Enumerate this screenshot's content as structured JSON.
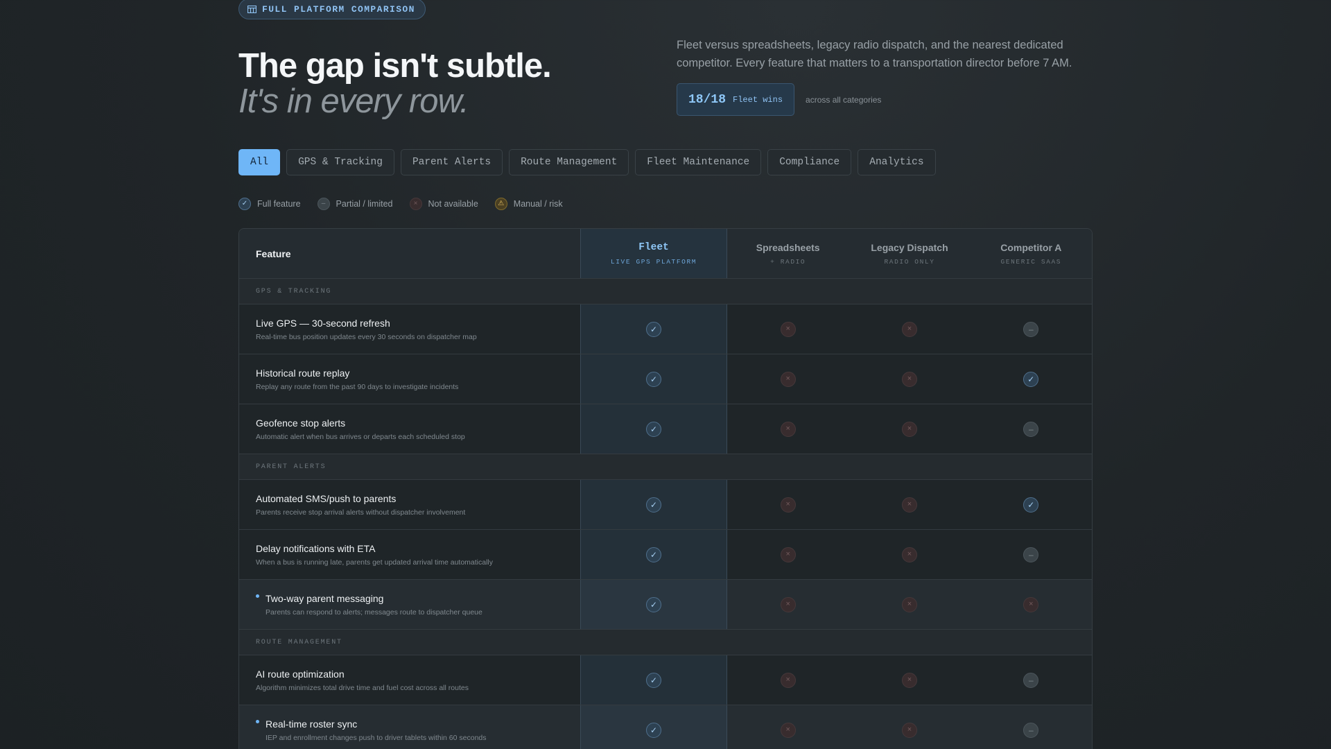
{
  "eyebrow": "FULL PLATFORM COMPARISON",
  "headline": {
    "line1": "The gap isn't subtle.",
    "line2": "It's in every row."
  },
  "intro": "Fleet versus spreadsheets, legacy radio dispatch, and the nearest dedicated competitor. Every feature that matters to a transportation director before 7 AM.",
  "wins": {
    "score": "18/18",
    "label": "Fleet wins",
    "note": "across all categories"
  },
  "tabs": [
    "All",
    "GPS & Tracking",
    "Parent Alerts",
    "Route Management",
    "Fleet Maintenance",
    "Compliance",
    "Analytics"
  ],
  "legend": [
    {
      "key": "full",
      "label": "Full feature"
    },
    {
      "key": "partial",
      "label": "Partial / limited"
    },
    {
      "key": "none",
      "label": "Not available"
    },
    {
      "key": "risk",
      "label": "Manual / risk"
    }
  ],
  "table": {
    "feature_header": "Feature",
    "columns": [
      {
        "name": "Fleet",
        "sub": "LIVE GPS PLATFORM"
      },
      {
        "name": "Spreadsheets",
        "sub": "+ RADIO"
      },
      {
        "name": "Legacy Dispatch",
        "sub": "RADIO ONLY"
      },
      {
        "name": "Competitor A",
        "sub": "GENERIC SAAS"
      }
    ],
    "sections": [
      {
        "title": "GPS & TRACKING",
        "rows": [
          {
            "title": "Live GPS — 30-second refresh",
            "desc": "Real-time bus position updates every 30 seconds on dispatcher map",
            "values": [
              "full",
              "none",
              "none",
              "partial"
            ],
            "new": false,
            "highlight": false
          },
          {
            "title": "Historical route replay",
            "desc": "Replay any route from the past 90 days to investigate incidents",
            "values": [
              "full",
              "none",
              "none",
              "full"
            ],
            "new": false,
            "highlight": false
          },
          {
            "title": "Geofence stop alerts",
            "desc": "Automatic alert when bus arrives or departs each scheduled stop",
            "values": [
              "full",
              "none",
              "none",
              "partial"
            ],
            "new": false,
            "highlight": false
          }
        ]
      },
      {
        "title": "PARENT ALERTS",
        "rows": [
          {
            "title": "Automated SMS/push to parents",
            "desc": "Parents receive stop arrival alerts without dispatcher involvement",
            "values": [
              "full",
              "none",
              "none",
              "full"
            ],
            "new": false,
            "highlight": false
          },
          {
            "title": "Delay notifications with ETA",
            "desc": "When a bus is running late, parents get updated arrival time automatically",
            "values": [
              "full",
              "none",
              "none",
              "partial"
            ],
            "new": false,
            "highlight": false
          },
          {
            "title": "Two-way parent messaging",
            "desc": "Parents can respond to alerts; messages route to dispatcher queue",
            "values": [
              "full",
              "none",
              "none",
              "none"
            ],
            "new": true,
            "highlight": true
          }
        ]
      },
      {
        "title": "ROUTE MANAGEMENT",
        "rows": [
          {
            "title": "AI route optimization",
            "desc": "Algorithm minimizes total drive time and fuel cost across all routes",
            "values": [
              "full",
              "none",
              "none",
              "partial"
            ],
            "new": false,
            "highlight": false
          },
          {
            "title": "Real-time roster sync",
            "desc": "IEP and enrollment changes push to driver tablets within 60 seconds",
            "values": [
              "full",
              "none",
              "none",
              "partial"
            ],
            "new": true,
            "highlight": true
          }
        ]
      }
    ]
  },
  "icons": {
    "full": "✓",
    "partial": "–",
    "none": "×",
    "risk": "⚠"
  },
  "colors": {
    "accent": "#6fb6f7",
    "background": "#202528",
    "risk": "#e8c364"
  }
}
